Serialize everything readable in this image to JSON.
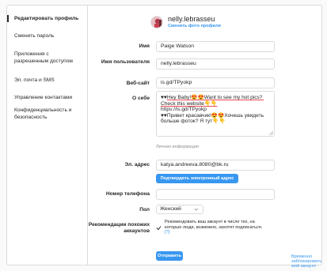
{
  "sidebar": {
    "items": [
      {
        "label": "Редактировать профиль"
      },
      {
        "label": "Сменить пароль"
      },
      {
        "label": "Приложения с разрешенным доступом"
      },
      {
        "label": "Эл. почта и SMS"
      },
      {
        "label": "Управление контактами"
      },
      {
        "label": "Конфиденциальность и безопасность"
      }
    ]
  },
  "profile": {
    "username": "nelly.lebrasseu",
    "change_photo": "Сменить фото профиля"
  },
  "form": {
    "name_label": "Имя",
    "name_value": "Paige Watson",
    "username_label": "Имя пользователя",
    "username_value": "nelly.lebrasseu",
    "website_label": "Веб-сайт",
    "website_value": "is.gd/TPyokp",
    "bio_label": "О себе",
    "bio_line1": "♥♥",
    "bio_link": "Hey Baby!😍😍Want to see my hot pics? Check this website👇👇",
    "bio_line2": "https://is.gd/TPyokp",
    "bio_line3": "♥♥Привет красавчик!😍😍Хочешь увидеть больше фоток? Я тут👇👇",
    "private_info_title": "Личная информация",
    "email_label": "Эл. адрес",
    "email_value": "katya.andreeva.8080@bk.ru",
    "confirm_email_button": "Подтвердить электронный адрес",
    "phone_label": "Номер телефона",
    "phone_value": "",
    "gender_label": "Пол",
    "gender_value": "Женский",
    "suggestions_label": "Рекомендации похожих аккаунтов",
    "suggestions_text": "Рекомендовать ваш аккаунт в числе тех, на которые люди, возможно, захотят подписаться.",
    "suggestions_help": "[?]",
    "suggestions_checked": true,
    "submit_button": "Отправить",
    "disable_link": "Временно заблокировать мой аккаунт"
  },
  "colors": {
    "accent": "#3897f0",
    "border": "#dbdbdb",
    "text": "#262626",
    "muted": "#8e8e8e"
  }
}
